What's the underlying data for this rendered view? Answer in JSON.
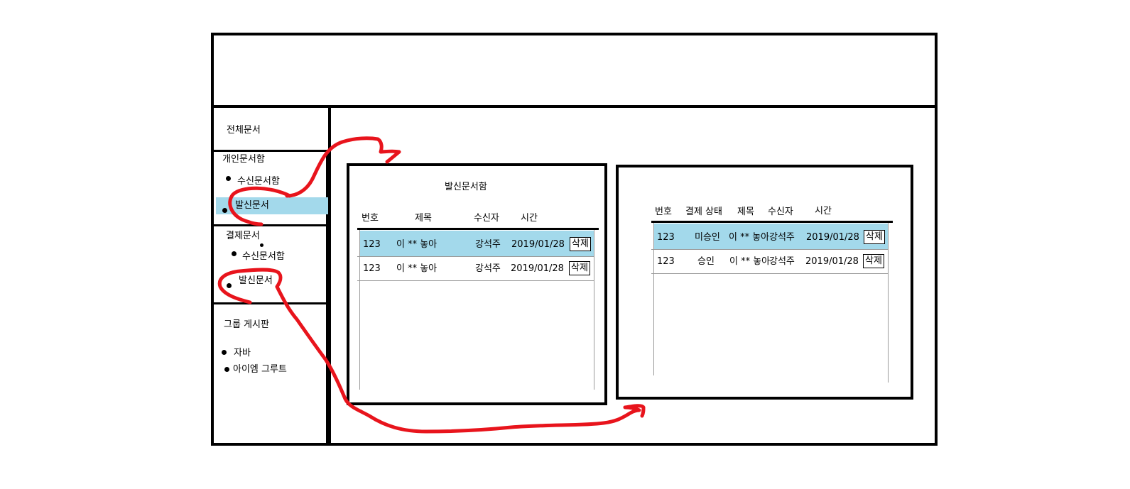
{
  "sidebar": {
    "all_docs": "전체문서",
    "personal": {
      "title": "개인문서함",
      "items": [
        "수신문서함",
        "발신문서"
      ]
    },
    "approval": {
      "title": "결제문서",
      "items": [
        "수신문서함",
        "발신문서"
      ]
    },
    "group": {
      "title": "그룹 게시판",
      "items": [
        "자바",
        "아이엠 그루트"
      ]
    }
  },
  "sent_panel": {
    "title": "발신문서함",
    "headers": [
      "번호",
      "제목",
      "수신자",
      "시간"
    ],
    "rows": [
      {
        "no": "123",
        "subject": "이 ** 놓아",
        "recipient": "강석주",
        "time": "2019/01/28",
        "action": "삭제"
      },
      {
        "no": "123",
        "subject": "이 ** 놓아",
        "recipient": "강석주",
        "time": "2019/01/28",
        "action": "삭제"
      }
    ]
  },
  "approval_panel": {
    "headers": [
      "번호",
      "결제 상태",
      "제목",
      "수신자",
      "시간"
    ],
    "rows": [
      {
        "no": "123",
        "status": "미승인",
        "subject": "이 ** 놓아",
        "recipient": "강석주",
        "time": "2019/01/28",
        "action": "삭제"
      },
      {
        "no": "123",
        "status": "승인",
        "subject": "이 ** 놓아",
        "recipient": "강석주",
        "time": "2019/01/28",
        "action": "삭제"
      }
    ]
  },
  "colors": {
    "highlight": "#a3d9eb",
    "annotation": "#e8141c",
    "border": "#000000"
  }
}
